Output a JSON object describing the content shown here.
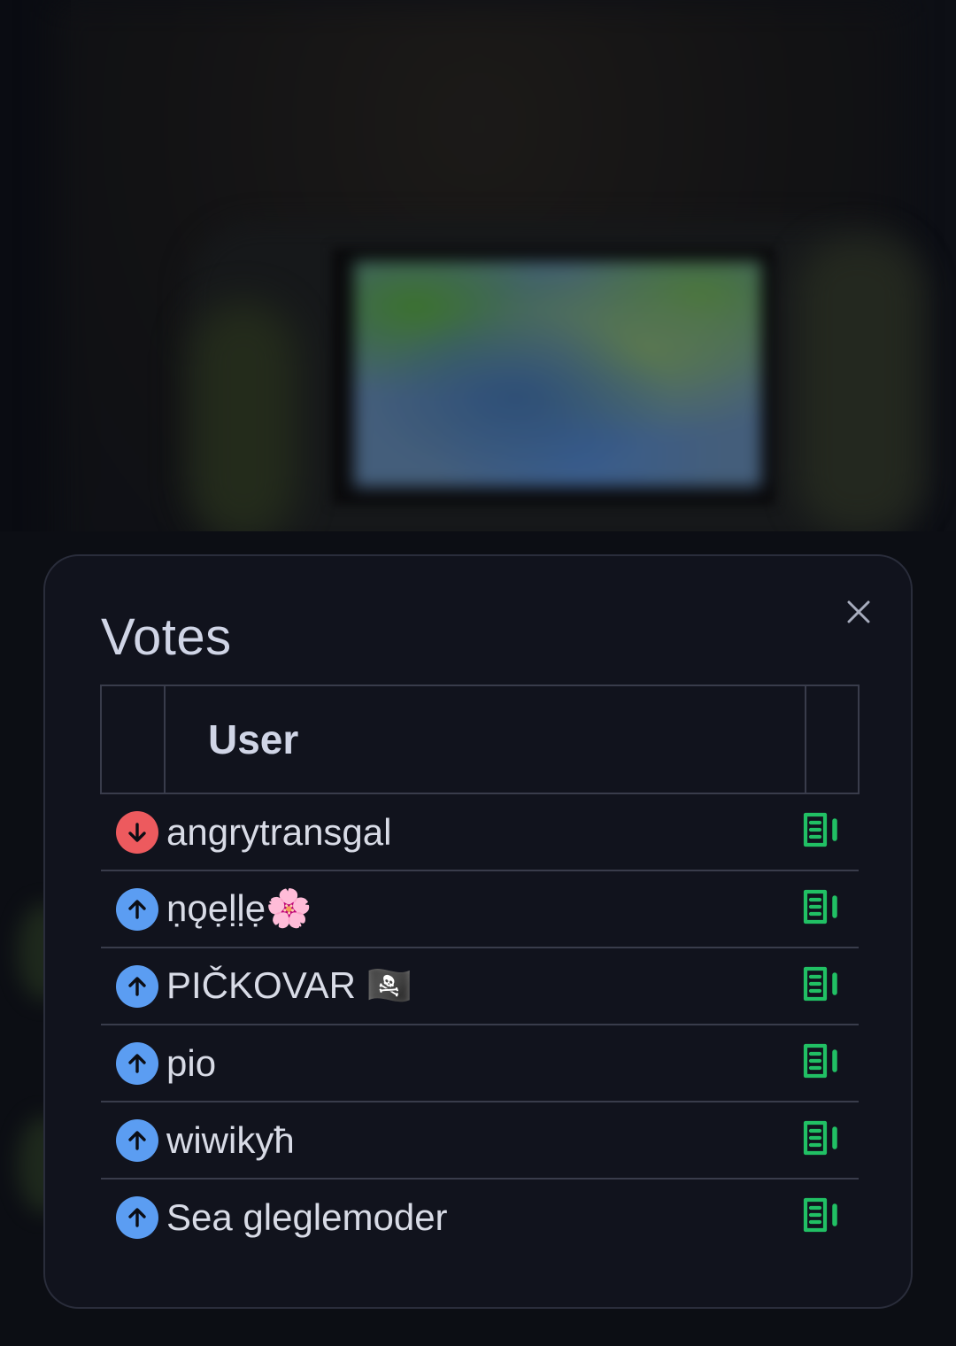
{
  "modal": {
    "title": "Votes",
    "close_icon": "close-icon"
  },
  "table": {
    "headers": [
      "",
      "User",
      ""
    ],
    "rows": [
      {
        "vote": "down",
        "user": "angrytransgal",
        "action_icon": "view-details-icon"
      },
      {
        "vote": "up",
        "user": "ṇǫẹḷḷẹ🌸",
        "action_icon": "view-details-icon"
      },
      {
        "vote": "up",
        "user": "PIČKOVAR 🏴‍☠️",
        "action_icon": "view-details-icon"
      },
      {
        "vote": "up",
        "user": "pio",
        "action_icon": "view-details-icon"
      },
      {
        "vote": "up",
        "user": "wiwikyħ",
        "action_icon": "view-details-icon"
      },
      {
        "vote": "up",
        "user": "Sea gleglemoder",
        "action_icon": "view-details-icon"
      }
    ]
  },
  "colors": {
    "upvote": "#5b9df2",
    "downvote": "#ed5a5e",
    "action": "#21c064",
    "modal_bg": "#11131d"
  }
}
